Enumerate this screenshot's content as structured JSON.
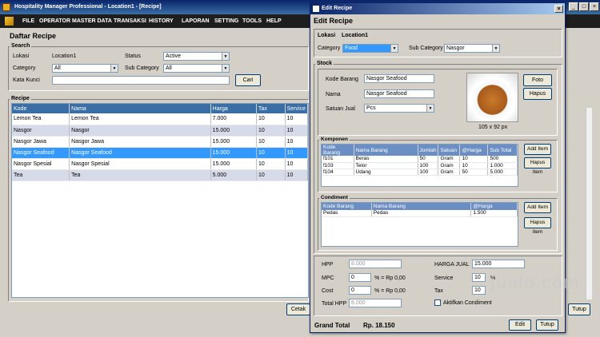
{
  "main_window": {
    "title": "Hospitality Manager Professional - Location1 - [Recipe]",
    "menu": [
      "FILE",
      "OPERATOR",
      "MASTER DATA",
      "TRANSAKSI",
      "HISTORY",
      "LAPORAN",
      "SETTING",
      "TOOLS",
      "HELP"
    ],
    "page_title": "Daftar Recipe",
    "search": {
      "group_title": "Search",
      "lokasi_label": "Lokasi",
      "lokasi_value": "Location1",
      "status_label": "Status",
      "status_value": "Active",
      "category_label": "Category",
      "category_value": "All",
      "subcategory_label": "Sub Category",
      "subcategory_value": "All",
      "katakunci_label": "Kata Kunci",
      "katakunci_value": "",
      "cari_label": "Cari"
    },
    "recipe": {
      "group_title": "Recipe",
      "columns": [
        "Kode",
        "Nama",
        "Harga",
        "Tax",
        "Service"
      ],
      "rows": [
        [
          "Lemon Tea",
          "Lemon Tea",
          "7.000",
          "10",
          "10"
        ],
        [
          "Nasgor",
          "Nasgor",
          "15.000",
          "10",
          "10"
        ],
        [
          "Nasgor Jawa",
          "Nasgor Jawa",
          "15.000",
          "10",
          "10"
        ],
        [
          "Nasgor Seafood",
          "Nasgor Seafood",
          "15.000",
          "10",
          "10"
        ],
        [
          "Nasgor Spesial",
          "Nasgor Spesial",
          "15.000",
          "10",
          "10"
        ],
        [
          "Tea",
          "Tea",
          "5.000",
          "10",
          "10"
        ]
      ],
      "selected_index": 3
    },
    "cetak_label": "Cetak",
    "tutup_label": "Tutup"
  },
  "dialog": {
    "title": "Edit Recipe",
    "heading": "Edit Recipe",
    "lokasi_label": "Lokasi",
    "lokasi_value": "Location1",
    "category_label": "Category",
    "category_value": "Food",
    "subcategory_label": "Sub Category",
    "subcategory_value": "Nasgor",
    "stock": {
      "group_title": "Stock",
      "kode_label": "Kode Barang",
      "kode_value": "Nasgor Seafood",
      "nama_label": "Nama",
      "nama_value": "Nasgor Seafood",
      "satuan_label": "Satuan Jual",
      "satuan_value": "Pcs",
      "foto_label": "Foto",
      "hapus_label": "Hapus",
      "photo_size": "105 x 92 px"
    },
    "komponen": {
      "group_title": "Komponen",
      "columns": [
        "Kode Barang",
        "Nama Barang",
        "Jumlah",
        "Satuan",
        "@Harga",
        "Sub Total"
      ],
      "rows": [
        [
          "f101",
          "Beras",
          "50",
          "Gram",
          "10",
          "500"
        ],
        [
          "f103",
          "Telor",
          "100",
          "Gram",
          "10",
          "1.000"
        ],
        [
          "f104",
          "Udang",
          "100",
          "Gram",
          "50",
          "5.000"
        ]
      ],
      "add_label": "Add Item",
      "hapus_label": "Hapus Item"
    },
    "condiment": {
      "group_title": "Condiment",
      "columns": [
        "Kode Barang",
        "Nama Barang",
        "@Harga"
      ],
      "rows": [
        [
          "Pedas",
          "Pedas",
          "1.500"
        ]
      ],
      "add_label": "Add Item",
      "hapus_label": "Hapus Item"
    },
    "totals": {
      "hpp_label": "HPP",
      "hpp_value": "8.000",
      "mpc_label": "MPC",
      "mpc_value": "0",
      "mpc_suffix": "% =  Rp 0,00",
      "cost_label": "Cost",
      "cost_value": "0",
      "cost_suffix": "% =  Rp 0,00",
      "totalhpp_label": "Total HPP",
      "totalhpp_value": "8.000",
      "hargajual_label": "HARGA JUAL",
      "hargajual_value": "15.000",
      "service_label": "Service",
      "service_value": "10",
      "service_suffix": "%",
      "tax_label": "Tax",
      "tax_value": "10",
      "aktifkan_label": "Aktifkan Condiment"
    },
    "grand_total_label": "Grand Total",
    "grand_total_value": "Rp. 18.150",
    "edit_label": "Edit",
    "tutup_label": "Tutup"
  },
  "watermark": "jualo.com",
  "colors": {
    "titlebar": "#0a246a",
    "menubar": "#1e1e1e",
    "header": "#3a6ea5",
    "selection": "#3399ff",
    "alt_row": "#d7dbe9"
  }
}
